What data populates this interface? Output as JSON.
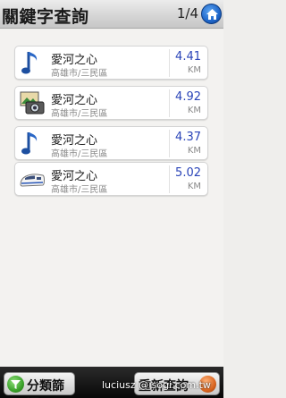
{
  "header": {
    "title": "關鍵字查詢",
    "page_indicator": "1/4",
    "home_icon": "home-icon",
    "accent": "#1f66c9"
  },
  "results": [
    {
      "name": "愛河之心",
      "address": "高雄市/三民區",
      "distance": "4.41",
      "unit": "KM",
      "icon": "music-note-icon"
    },
    {
      "name": "愛河之心",
      "address": "高雄市/三民區",
      "distance": "4.92",
      "unit": "KM",
      "icon": "photo-camera-icon"
    },
    {
      "name": "愛河之心",
      "address": "高雄市/三民區",
      "distance": "4.37",
      "unit": "KM",
      "icon": "music-note-icon"
    },
    {
      "name": "愛河之心",
      "address": "高雄市/三民區",
      "distance": "5.02",
      "unit": "KM",
      "icon": "bullet-train-icon"
    }
  ],
  "footer": {
    "filter_label": "分類篩選",
    "requery_label": "重新查詢",
    "watermark": "luciusz @ sogi.com.tw"
  },
  "colors": {
    "distance": "#2a44b8",
    "secondary_text": "#8a8a8a"
  }
}
